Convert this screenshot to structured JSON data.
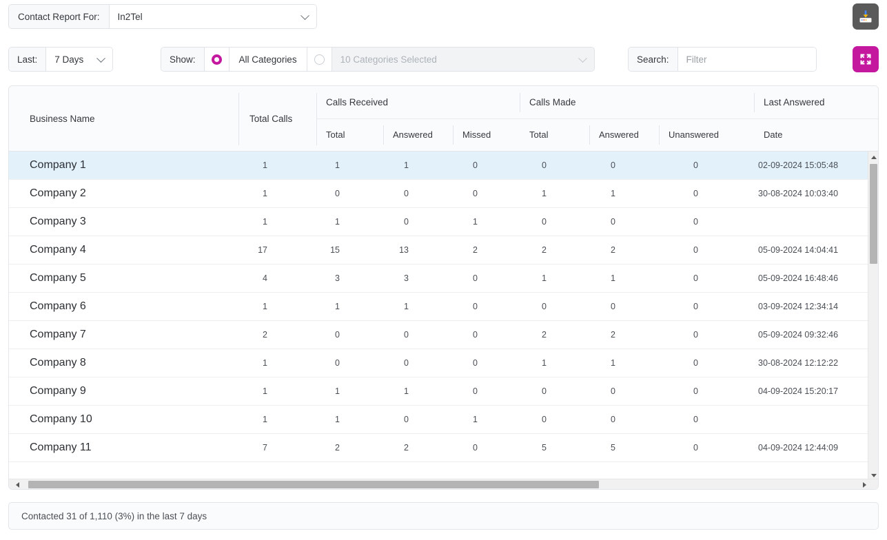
{
  "topbar": {
    "report_label": "Contact Report For:",
    "report_value": "In2Tel",
    "download_icon": "download-icon"
  },
  "filterbar": {
    "last_label": "Last:",
    "last_value": "7 Days",
    "show_label": "Show:",
    "all_categories_label": "All Categories",
    "all_categories_selected": true,
    "categories_value": "10 Categories Selected",
    "categories_enabled": false,
    "search_label": "Search:",
    "search_value": "",
    "search_placeholder": "Filter",
    "expand_icon": "expand-icon"
  },
  "colors": {
    "accent": "#c4189e",
    "download_button": "#5a5a5a",
    "selected_row": "#e3f1fb"
  },
  "table": {
    "groups": [
      {
        "label": "Calls Received"
      },
      {
        "label": "Calls Made"
      },
      {
        "label": "Last Answered"
      }
    ],
    "columns": [
      {
        "key": "name",
        "label": "Business Name"
      },
      {
        "key": "total_calls",
        "label": "Total Calls"
      },
      {
        "key": "recv_total",
        "label": "Total"
      },
      {
        "key": "recv_answered",
        "label": "Answered"
      },
      {
        "key": "recv_missed",
        "label": "Missed"
      },
      {
        "key": "made_total",
        "label": "Total"
      },
      {
        "key": "made_answered",
        "label": "Answered"
      },
      {
        "key": "made_unanswered",
        "label": "Unanswered"
      },
      {
        "key": "last_answered_date",
        "label": "Date"
      }
    ],
    "rows": [
      {
        "name": "Company 1",
        "total_calls": "1",
        "recv_total": "1",
        "recv_answered": "1",
        "recv_missed": "0",
        "made_total": "0",
        "made_answered": "0",
        "made_unanswered": "0",
        "last_answered_date": "02-09-2024 15:05:48",
        "selected": true
      },
      {
        "name": "Company 2",
        "total_calls": "1",
        "recv_total": "0",
        "recv_answered": "0",
        "recv_missed": "0",
        "made_total": "1",
        "made_answered": "1",
        "made_unanswered": "0",
        "last_answered_date": "30-08-2024 10:03:40",
        "selected": false
      },
      {
        "name": "Company 3",
        "total_calls": "1",
        "recv_total": "1",
        "recv_answered": "0",
        "recv_missed": "1",
        "made_total": "0",
        "made_answered": "0",
        "made_unanswered": "0",
        "last_answered_date": "",
        "selected": false
      },
      {
        "name": "Company 4",
        "total_calls": "17",
        "recv_total": "15",
        "recv_answered": "13",
        "recv_missed": "2",
        "made_total": "2",
        "made_answered": "2",
        "made_unanswered": "0",
        "last_answered_date": "05-09-2024 14:04:41",
        "selected": false
      },
      {
        "name": "Company 5",
        "total_calls": "4",
        "recv_total": "3",
        "recv_answered": "3",
        "recv_missed": "0",
        "made_total": "1",
        "made_answered": "1",
        "made_unanswered": "0",
        "last_answered_date": "05-09-2024 16:48:46",
        "selected": false
      },
      {
        "name": "Company 6",
        "total_calls": "1",
        "recv_total": "1",
        "recv_answered": "1",
        "recv_missed": "0",
        "made_total": "0",
        "made_answered": "0",
        "made_unanswered": "0",
        "last_answered_date": "03-09-2024 12:34:14",
        "selected": false
      },
      {
        "name": "Company 7",
        "total_calls": "2",
        "recv_total": "0",
        "recv_answered": "0",
        "recv_missed": "0",
        "made_total": "2",
        "made_answered": "2",
        "made_unanswered": "0",
        "last_answered_date": "05-09-2024 09:32:46",
        "selected": false
      },
      {
        "name": "Company 8",
        "total_calls": "1",
        "recv_total": "0",
        "recv_answered": "0",
        "recv_missed": "0",
        "made_total": "1",
        "made_answered": "1",
        "made_unanswered": "0",
        "last_answered_date": "30-08-2024 12:12:22",
        "selected": false
      },
      {
        "name": "Company 9",
        "total_calls": "1",
        "recv_total": "1",
        "recv_answered": "1",
        "recv_missed": "0",
        "made_total": "0",
        "made_answered": "0",
        "made_unanswered": "0",
        "last_answered_date": "04-09-2024 15:20:17",
        "selected": false
      },
      {
        "name": "Company 10",
        "total_calls": "1",
        "recv_total": "1",
        "recv_answered": "0",
        "recv_missed": "1",
        "made_total": "0",
        "made_answered": "0",
        "made_unanswered": "0",
        "last_answered_date": "",
        "selected": false
      },
      {
        "name": "Company 11",
        "total_calls": "7",
        "recv_total": "2",
        "recv_answered": "2",
        "recv_missed": "0",
        "made_total": "5",
        "made_answered": "5",
        "made_unanswered": "0",
        "last_answered_date": "04-09-2024 12:44:09",
        "selected": false
      }
    ]
  },
  "footer": {
    "status": "Contacted 31 of 1,110 (3%) in the last 7 days"
  }
}
